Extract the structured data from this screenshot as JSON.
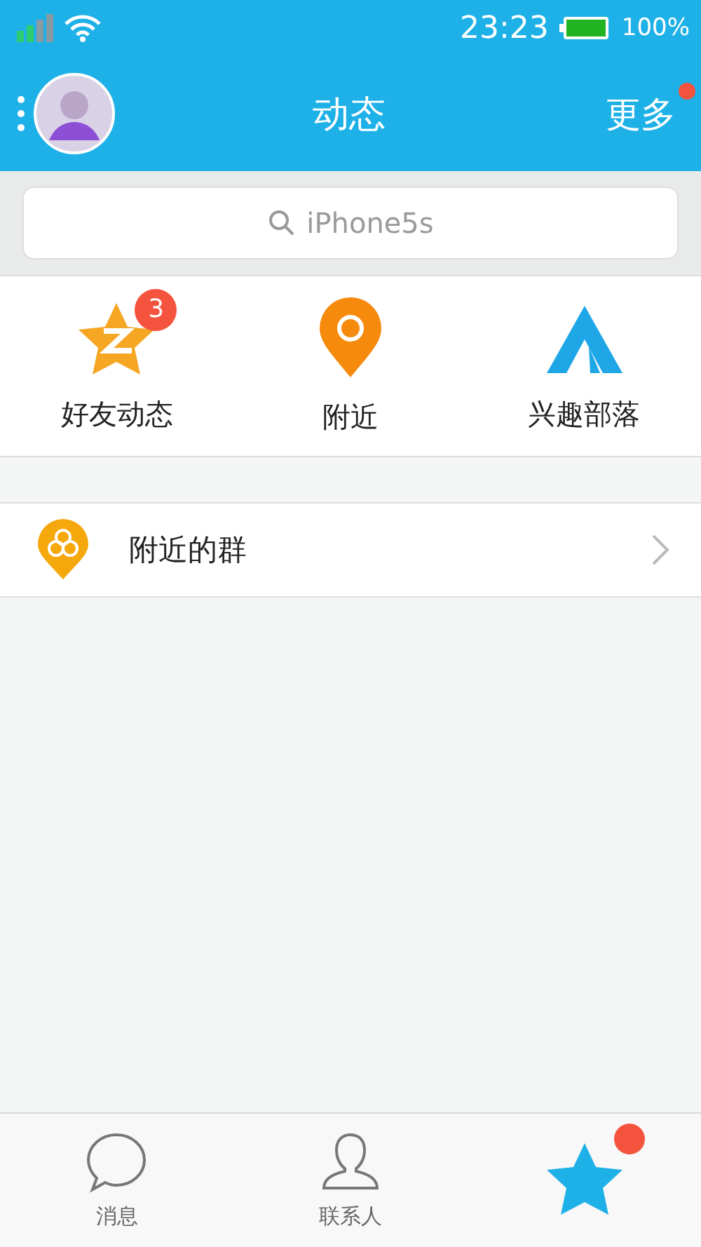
{
  "status_bar": {
    "time": "23:23",
    "battery": "100%"
  },
  "header": {
    "title": "动态",
    "more": "更多",
    "more_dot": true
  },
  "search": {
    "placeholder": "iPhone5s"
  },
  "shortcuts": [
    {
      "kind": "star",
      "label": "好友动态",
      "badge": "3"
    },
    {
      "kind": "pin",
      "label": "附近"
    },
    {
      "kind": "tent",
      "label": "兴趣部落"
    }
  ],
  "list": [
    {
      "label": "附近的群"
    }
  ],
  "tabs": [
    {
      "kind": "chat",
      "label": "消息",
      "selected": false
    },
    {
      "kind": "contact",
      "label": "联系人",
      "selected": false
    },
    {
      "kind": "star",
      "selected": true,
      "badge": true
    }
  ]
}
